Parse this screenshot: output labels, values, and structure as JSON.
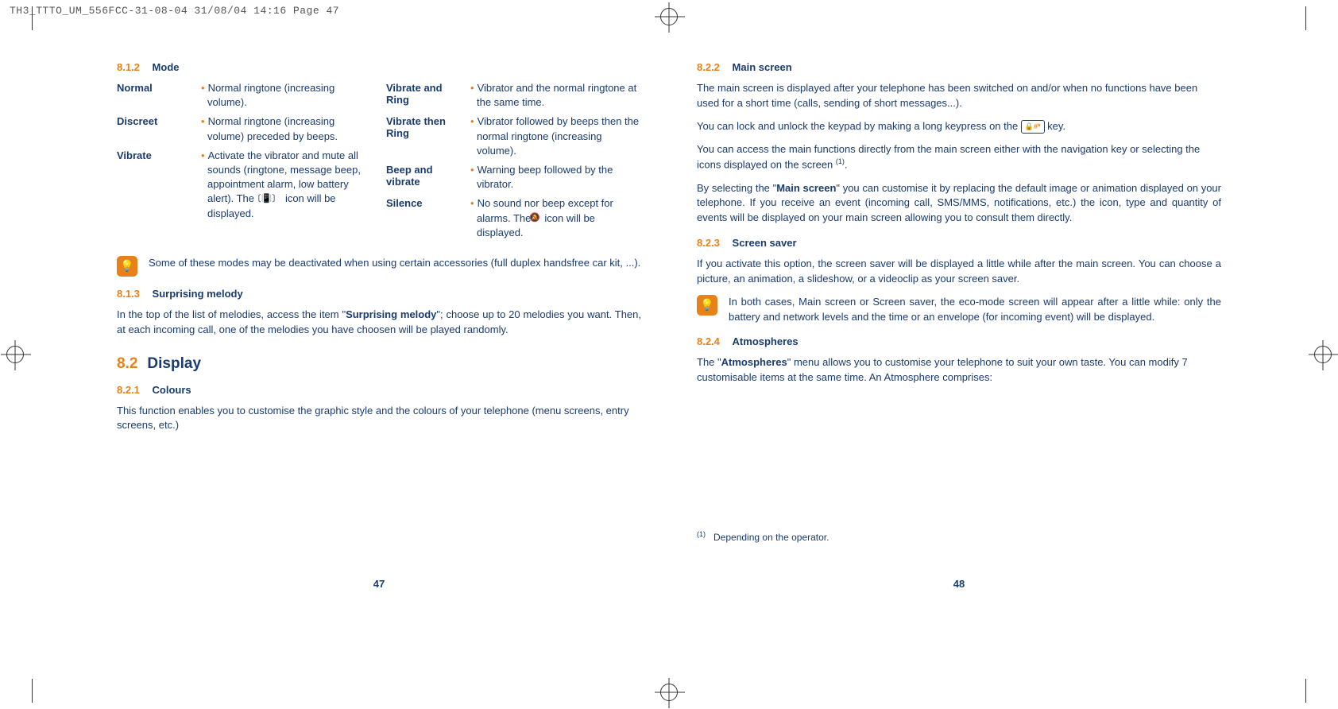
{
  "header": "TH3_TTTO_UM_556FCC-31-08-04  31/08/04  14:16  Page 47",
  "left": {
    "s812_num": "8.1.2",
    "s812_title": "Mode",
    "modes_col1": {
      "normal_label": "Normal",
      "normal_desc": "Normal ringtone (increasing volume).",
      "discreet_label": "Discreet",
      "discreet_desc": "Normal ringtone (increasing volume) preceded by beeps.",
      "vibrate_label": "Vibrate",
      "vibrate_desc_a": "Activate the vibrator and mute all sounds (ringtone, message beep, appointment alarm, low battery alert). The ",
      "vibrate_desc_b": " icon will be displayed."
    },
    "modes_col2": {
      "vibring_label": "Vibrate and Ring",
      "vibring_desc": "Vibrator and the normal ringtone at the same time.",
      "vibthen_label": "Vibrate then Ring",
      "vibthen_desc": "Vibrator followed by beeps then the normal ringtone (increasing volume).",
      "beepvib_label": "Beep and vibrate",
      "beepvib_desc": "Warning beep followed by the vibrator.",
      "silence_label": "Silence",
      "silence_desc_a": "No sound nor beep except for alarms. The ",
      "silence_desc_b": " icon will be displayed."
    },
    "note1": "Some of these modes may be deactivated when using certain accessories (full duplex handsfree car kit, ...).",
    "s813_num": "8.1.3",
    "s813_title": "Surprising melody",
    "s813_p_a": "In the top of the list of melodies, access the item \"",
    "s813_p_bold": "Surprising melody",
    "s813_p_b": "\"; choose up to 20 melodies you want. Then, at each incoming call, one of the melodies you have choosen will be played randomly.",
    "s82_num": "8.2",
    "s82_title": "Display",
    "s821_num": "8.2.1",
    "s821_title": "Colours",
    "s821_p": "This function enables you to customise the graphic style and the colours of your telephone (menu screens, entry screens, etc.)",
    "page_num": "47"
  },
  "right": {
    "s822_num": "8.2.2",
    "s822_title": "Main screen",
    "s822_p1": "The main screen is displayed after your telephone has been switched on and/or when no functions have been used for a short time (calls, sending of short messages...).",
    "s822_p2_a": "You can lock and unlock the keypad by making a long keypress on the ",
    "s822_p2_b": " key.",
    "s822_p3_a": "You can access the main functions directly from the main screen either with the navigation key or selecting the icons displayed on the screen ",
    "s822_p3_b": ".",
    "s822_p4_a": "By selecting the \"",
    "s822_p4_bold": "Main screen",
    "s822_p4_b": "\" you can customise it by replacing the default image or animation displayed on your telephone. If you receive an event (incoming call, SMS/MMS, notifications, etc.) the icon, type and quantity of events will be displayed on your main screen allowing you to consult them directly.",
    "s823_num": "8.2.3",
    "s823_title": "Screen saver",
    "s823_p": "If you activate this option, the screen saver will be displayed a little while after the main screen. You can choose a picture, an animation, a slideshow, or a videoclip as your screen saver.",
    "note2": "In both cases, Main screen or Screen saver, the eco-mode screen will appear after a little while: only the battery and network levels and the time or an envelope (for incoming event) will be displayed.",
    "s824_num": "8.2.4",
    "s824_title": "Atmospheres",
    "s824_p_a": "The \"",
    "s824_p_bold": "Atmospheres",
    "s824_p_b": "\" menu allows you to customise your telephone to suit your own taste. You can modify 7 customisable items at the same time. An Atmosphere comprises:",
    "footnote_marker": "(1)",
    "footnote_text": "Depending on the operator.",
    "page_num": "48"
  }
}
